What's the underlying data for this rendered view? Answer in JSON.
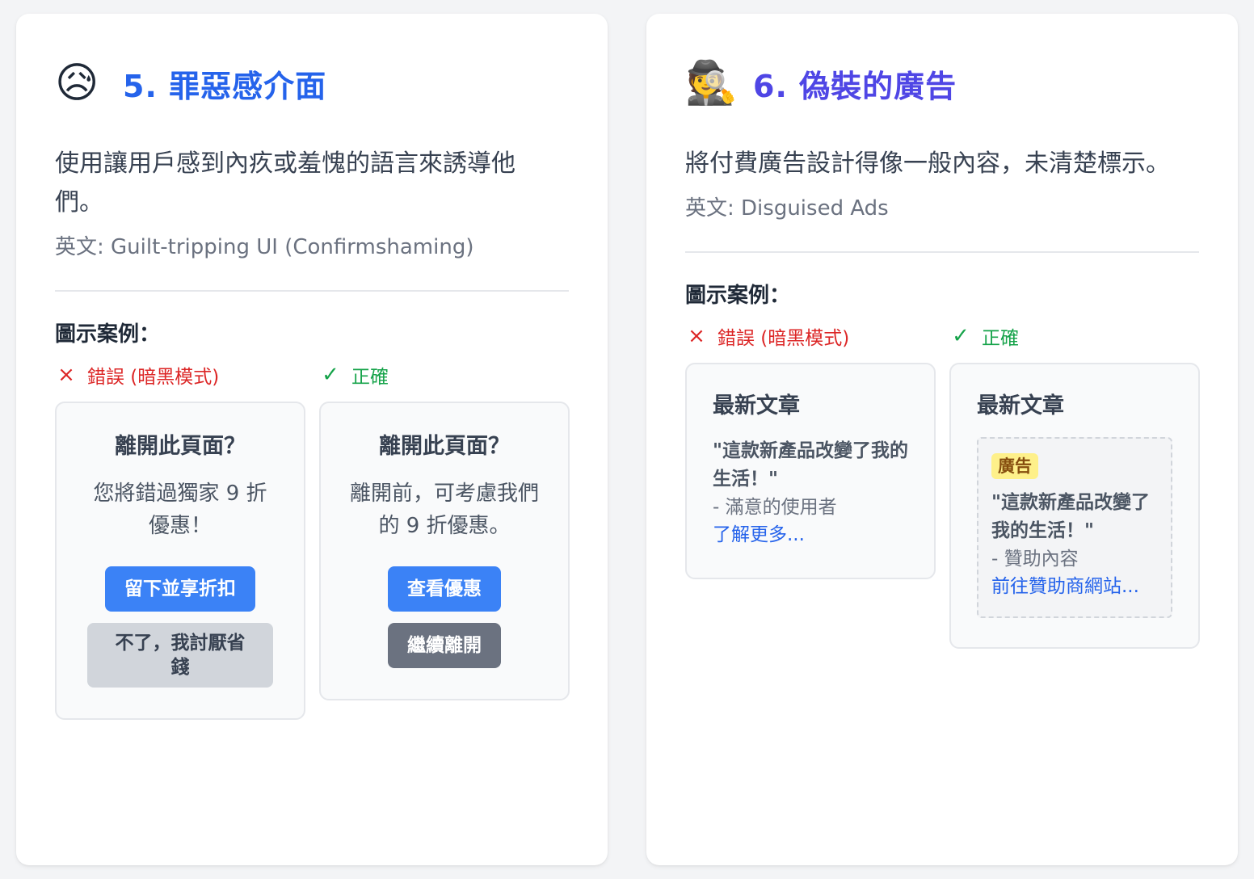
{
  "cards": [
    {
      "emoji": "😥",
      "title": "5. 罪惡感介面",
      "title_color": "#2563eb",
      "description": "使用讓用戶感到內疚或羞愧的語言來誘導他們。",
      "english": "英文: Guilt-tripping UI (Confirmshaming)",
      "section_label": "圖示案例：",
      "bad_label": "錯誤 (暗黑模式)",
      "good_label": "正確",
      "bad_example": {
        "heading": "離開此頁面？",
        "text": "您將錯過獨家 9 折優惠！",
        "primary_button": "留下並享折扣",
        "secondary_button": "不了，我討厭省錢"
      },
      "good_example": {
        "heading": "離開此頁面？",
        "text": "離開前，可考慮我們的 9 折優惠。",
        "primary_button": "查看優惠",
        "secondary_button": "繼續離開"
      }
    },
    {
      "emoji": "🕵️",
      "title": "6. 偽裝的廣告",
      "title_color": "#4f46e5",
      "description": "將付費廣告設計得像一般內容，未清楚標示。",
      "english": "英文: Disguised Ads",
      "section_label": "圖示案例：",
      "bad_label": "錯誤 (暗黑模式)",
      "good_label": "正確",
      "bad_example": {
        "heading": "最新文章",
        "quote": "\"這款新產品改變了我的生活！\"",
        "author": "- 滿意的使用者",
        "link": "了解更多..."
      },
      "good_example": {
        "heading": "最新文章",
        "badge": "廣告",
        "quote": "\"這款新產品改變了我的生活！\"",
        "author": "- 贊助內容",
        "link": "前往贊助商網站..."
      }
    }
  ],
  "icons": {
    "bad": "×",
    "good": "✓"
  }
}
